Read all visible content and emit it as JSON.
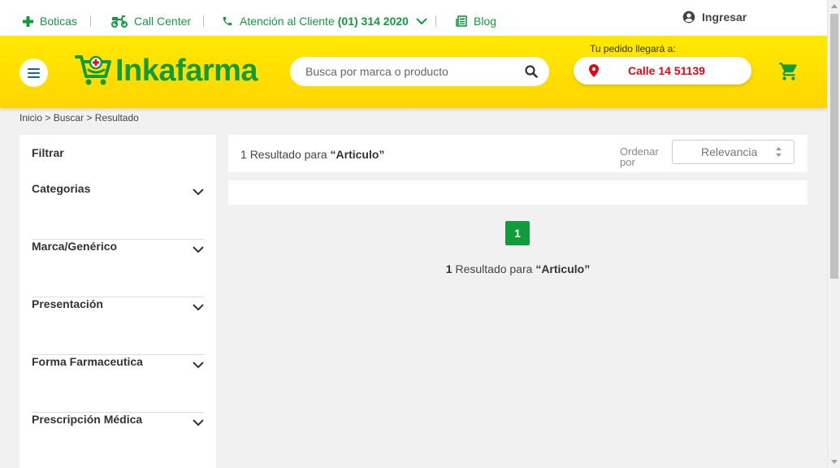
{
  "topbar": {
    "boticas": "Boticas",
    "call_center": "Call Center",
    "atencion_label": "Atención al Cliente",
    "atencion_phone": "(01) 314 2020",
    "blog": "Blog",
    "ingresar": "Ingresar"
  },
  "header": {
    "logo_text": "Inkafarma",
    "search_placeholder": "Busca por marca o producto",
    "delivery_label": "Tu pedido llegará a:",
    "address": "Calle 14 51139"
  },
  "breadcrumb": {
    "items": [
      "Inicio",
      "Buscar",
      "Resultado"
    ],
    "separator": ">"
  },
  "sidebar": {
    "title": "Filtrar",
    "filters": [
      "Categorias",
      "Marca/Genérico",
      "Presentación",
      "Forma Farmaceutica",
      "Prescripción Médica"
    ]
  },
  "results": {
    "count": "1",
    "label": "Resultado para",
    "query": "“Articulo”",
    "order_label": "Ordenar por",
    "order_value": "Relevancia",
    "page": "1"
  },
  "colors": {
    "brand_green": "#119c3c",
    "header_yellow": "#ffde00",
    "address_red": "#e30613"
  }
}
